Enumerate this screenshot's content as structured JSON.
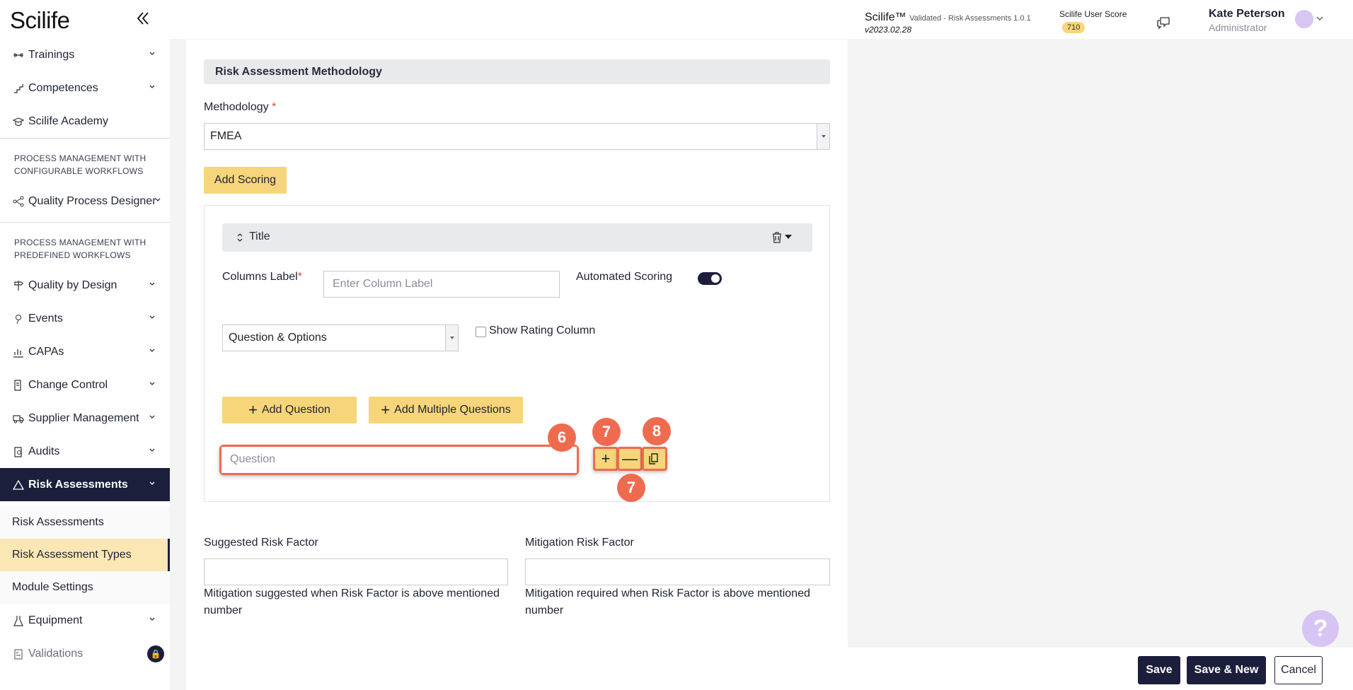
{
  "app": {
    "logo": "Scilife"
  },
  "header": {
    "brand": "Scilife™",
    "brand_sub": "Validated - Risk Assessments 1.0.1",
    "version": "v2023.02.28",
    "score_label": "Scilife User Score",
    "score_value": "710",
    "user_name": "Kate Peterson",
    "user_role": "Administrator"
  },
  "sidebar": {
    "items_top": [
      {
        "label": "Trainings",
        "icon": "dumbbell-icon"
      },
      {
        "label": "Competences",
        "icon": "stairs-icon"
      },
      {
        "label": "Scilife Academy",
        "icon": "graduation-cap-icon"
      }
    ],
    "section1": "PROCESS MANAGEMENT WITH CONFIGURABLE WORKFLOWS",
    "qpd": "Quality Process Designer",
    "section2": "PROCESS MANAGEMENT WITH PREDEFINED WORKFLOWS",
    "items_mid": [
      {
        "label": "Quality by Design",
        "icon": "signpost-icon"
      },
      {
        "label": "Events",
        "icon": "pin-icon"
      },
      {
        "label": "CAPAs",
        "icon": "chart-icon"
      },
      {
        "label": "Change Control",
        "icon": "document-edit-icon"
      },
      {
        "label": "Supplier Management",
        "icon": "truck-icon"
      },
      {
        "label": "Audits",
        "icon": "clipboard-search-icon"
      }
    ],
    "active": "Risk Assessments",
    "sub_items": [
      "Risk Assessments",
      "Risk Assessment Types",
      "Module Settings"
    ],
    "items_bottom": [
      {
        "label": "Equipment",
        "icon": "flask-icon"
      },
      {
        "label": "Validations",
        "icon": "checklist-icon"
      }
    ]
  },
  "form": {
    "section_title": "Risk Assessment Methodology",
    "methodology_label": "Methodology",
    "required_mark": "*",
    "methodology_value": "FMEA",
    "add_scoring": "Add Scoring",
    "scoring_title": "Title",
    "columns_label": "Columns Label",
    "columns_placeholder": "Enter Column Label",
    "automated_scoring": "Automated Scoring",
    "question_type": "Question & Options",
    "show_rating": "Show Rating Column",
    "add_question": "Add Question",
    "add_multiple": "Add Multiple Questions",
    "question_placeholder": "Question",
    "suggested_label": "Suggested Risk Factor",
    "suggested_help": "Mitigation suggested when Risk Factor is above mentioned number",
    "mitigation_label": "Mitigation Risk Factor",
    "mitigation_help": "Mitigation required when Risk Factor is above mentioned number"
  },
  "markers": {
    "m6": "6",
    "m7a": "7",
    "m7b": "7",
    "m8": "8"
  },
  "footer": {
    "save": "Save",
    "save_new": "Save & New",
    "cancel": "Cancel"
  },
  "colors": {
    "accent_yellow": "#f7d57a",
    "navy": "#1b1f3b",
    "annotation": "#ef6b4f"
  }
}
